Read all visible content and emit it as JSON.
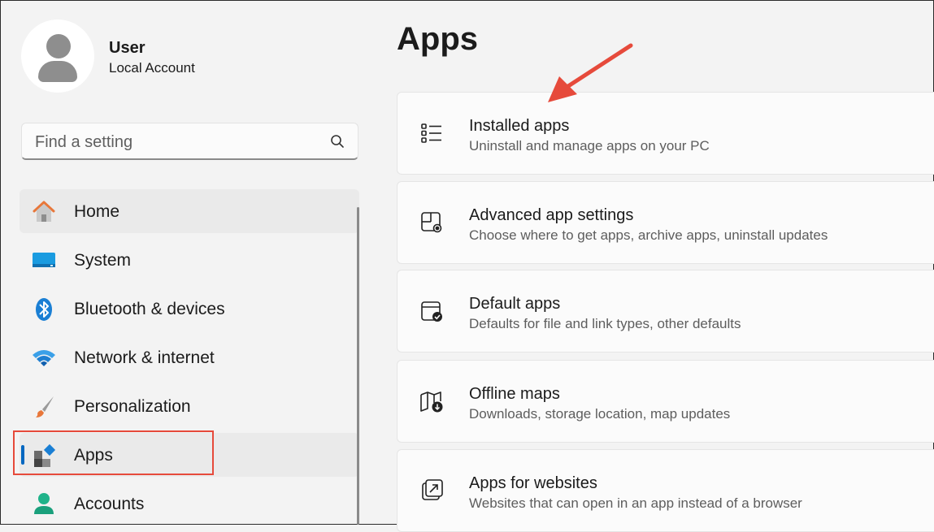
{
  "profile": {
    "name": "User",
    "account_type": "Local Account"
  },
  "search": {
    "placeholder": "Find a setting"
  },
  "sidebar": {
    "items": [
      {
        "label": "Home",
        "icon": "home-icon"
      },
      {
        "label": "System",
        "icon": "system-icon"
      },
      {
        "label": "Bluetooth & devices",
        "icon": "bluetooth-icon"
      },
      {
        "label": "Network & internet",
        "icon": "wifi-icon"
      },
      {
        "label": "Personalization",
        "icon": "brush-icon"
      },
      {
        "label": "Apps",
        "icon": "apps-icon",
        "selected": true
      },
      {
        "label": "Accounts",
        "icon": "accounts-icon"
      }
    ]
  },
  "main": {
    "title": "Apps",
    "cards": [
      {
        "title": "Installed apps",
        "description": "Uninstall and manage apps on your PC",
        "icon": "list-icon"
      },
      {
        "title": "Advanced app settings",
        "description": "Choose where to get apps, archive apps, uninstall updates",
        "icon": "app-settings-icon"
      },
      {
        "title": "Default apps",
        "description": "Defaults for file and link types, other defaults",
        "icon": "default-apps-icon"
      },
      {
        "title": "Offline maps",
        "description": "Downloads, storage location, map updates",
        "icon": "map-download-icon"
      },
      {
        "title": "Apps for websites",
        "description": "Websites that can open in an app instead of a browser",
        "icon": "open-external-icon"
      }
    ]
  },
  "colors": {
    "accent": "#0067c0",
    "annotation": "#e64a3b",
    "background": "#f3f3f3",
    "card": "#fbfbfb"
  }
}
